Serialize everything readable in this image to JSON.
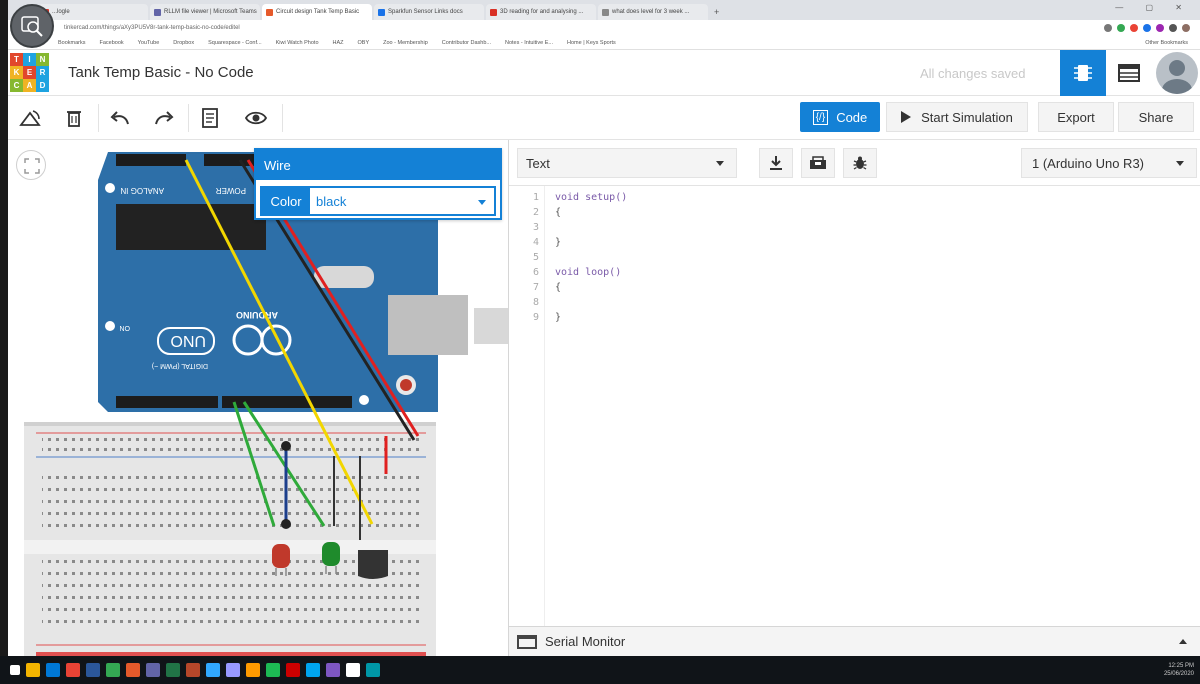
{
  "browser": {
    "tabs": [
      {
        "label": "...logle",
        "fav": "#d93025"
      },
      {
        "label": "RLLM file viewer | Microsoft Teams",
        "fav": "#6264a7"
      },
      {
        "label": "Circuit design Tank Temp Basic",
        "fav": "#e65a2b",
        "active": true
      },
      {
        "label": "Sparkfun Sensor Links docs",
        "fav": "#1a73e8"
      },
      {
        "label": "3D reading for and analysing ...",
        "fav": "#d93025"
      },
      {
        "label": "what does level for 3 week ...",
        "fav": "#888888"
      }
    ],
    "new_tab": "+",
    "window_controls": "— ▢ ✕",
    "url": "tinkercad.com/things/aXy3PU5V8r-tank-temp-basic-no-code/editel",
    "bookmarks": [
      "Bookmarks",
      "Facebook",
      "YouTube",
      "Dropbox",
      "Squarespace - Conf...",
      "Kiwi Watch Photo",
      "HAZ",
      "OBY",
      "Zoo - Membership",
      "Contributor Dashb...",
      "Notes - Intuitive E...",
      "Home | Keys Sports"
    ],
    "other_bookmarks": "Other Bookmarks"
  },
  "header": {
    "logo_letters": [
      "T",
      "I",
      "N",
      "K",
      "E",
      "R",
      "C",
      "A",
      "D"
    ],
    "logo_colors": [
      "#e1472c",
      "#1ea3e0",
      "#86b82f",
      "#f0b323",
      "#e1472c",
      "#1ea3e0",
      "#86b82f",
      "#f0b323",
      "#1ea3e0"
    ],
    "title": "Tank Temp Basic - No Code",
    "save_status": "All changes saved"
  },
  "toolbar": {
    "code_label": "Code",
    "code_icon": "{/}",
    "start_sim_label": "Start Simulation",
    "export_label": "Export",
    "share_label": "Share"
  },
  "wire_popover": {
    "title": "Wire",
    "color_label": "Color",
    "color_value": "black"
  },
  "arduino": {
    "analog_label": "ANALOG IN",
    "power_label": "POWER",
    "brand": "ARDUINO",
    "model": "UNO",
    "on_label": "ON",
    "digital_label": "DIGITAL (PWM ~)"
  },
  "code_panel": {
    "mode": "Text",
    "board": "1 (Arduino Uno R3)",
    "line_numbers": [
      "1",
      "2",
      "3",
      "4",
      "5",
      "6",
      "7",
      "8",
      "9"
    ],
    "lines": [
      "void setup()",
      "{",
      "",
      "}",
      "",
      "void loop()",
      "{",
      "",
      "}"
    ],
    "serial_monitor": "Serial Monitor"
  },
  "taskbar": {
    "time": "12:25 PM",
    "date": "25/06/2020"
  },
  "colors": {
    "accent": "#1481d6",
    "wire_black": "#222222",
    "wire_red": "#e02020",
    "wire_yellow": "#f2d600",
    "wire_green": "#2faa3a",
    "wire_blue": "#1c3f8c",
    "board_blue": "#2d6fa8"
  }
}
